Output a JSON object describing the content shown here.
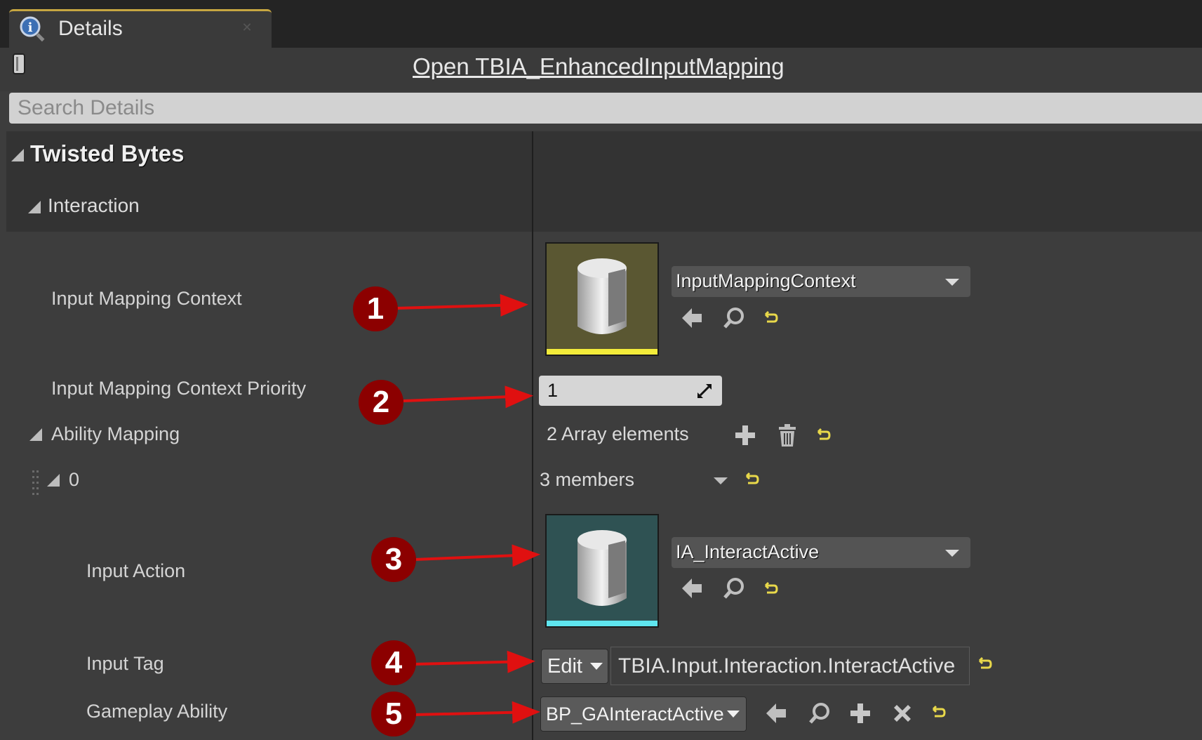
{
  "tab": {
    "label": "Details",
    "icon": "info-magnifier-icon"
  },
  "header": {
    "open_link": "Open TBIA_EnhancedInputMapping",
    "lock_icon": "lock-icon"
  },
  "search": {
    "placeholder": "Search Details"
  },
  "category": {
    "label": "Twisted Bytes",
    "subcategory": "Interaction"
  },
  "properties": {
    "input_mapping_context": {
      "label": "Input Mapping Context",
      "value": "InputMappingContext",
      "thumb_color": "#5a5732",
      "bar_color": "#f3ec3a"
    },
    "priority": {
      "label": "Input Mapping Context Priority",
      "value": "1"
    },
    "ability_mapping": {
      "label": "Ability Mapping",
      "summary": "2 Array elements"
    },
    "element_0": {
      "label": "0",
      "summary": "3 members"
    },
    "input_action": {
      "label": "Input Action",
      "value": "IA_InteractActive",
      "thumb_color": "#2f5253",
      "bar_color": "#5fe6ef"
    },
    "input_tag": {
      "label": "Input Tag",
      "edit_label": "Edit",
      "value": "TBIA.Input.Interaction.InteractActive"
    },
    "gameplay_ability": {
      "label": "Gameplay Ability",
      "value": "BP_GAInteractActive"
    }
  },
  "annotations": [
    "1",
    "2",
    "3",
    "4",
    "5"
  ],
  "colors": {
    "annotation": "#8c0000",
    "arrow": "#e01010",
    "reset": "#e8d84a"
  }
}
